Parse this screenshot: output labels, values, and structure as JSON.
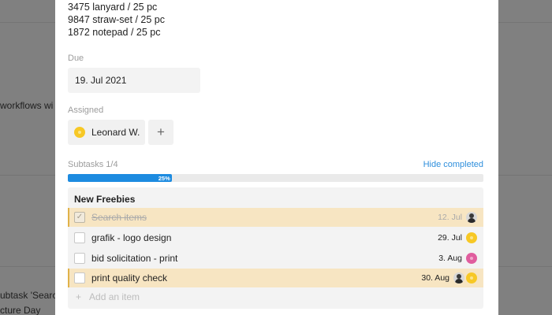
{
  "background": {
    "fragment_1": "workflows wi",
    "fragment_2": "ubtask 'Searc",
    "fragment_3": "cture Day"
  },
  "notes": {
    "lines": [
      "3475 lanyard / 25 pc",
      "9847 straw-set / 25 pc",
      "1872 notepad / 25 pc"
    ]
  },
  "due": {
    "label": "Due",
    "value": "19. Jul 2021"
  },
  "assigned": {
    "label": "Assigned",
    "name": "Leonard W.",
    "add_icon": "+"
  },
  "subtasks": {
    "label": "Subtasks 1/4",
    "hide_completed": "Hide completed",
    "progress_label": "25%",
    "progress_fraction": 0.25,
    "accent_color": "#1d8be0",
    "list_title": "New Freebies",
    "items": [
      {
        "text": "Search items",
        "date": "12. Jul",
        "completed": true,
        "highlighted": true,
        "avatars": [
          "photo"
        ]
      },
      {
        "text": "grafik - logo design",
        "date": "29. Jul",
        "completed": false,
        "highlighted": false,
        "avatars": [
          "yellow"
        ]
      },
      {
        "text": "bid solicitation - print",
        "date": "3. Aug",
        "completed": false,
        "highlighted": false,
        "avatars": [
          "pink"
        ]
      },
      {
        "text": "print quality check",
        "date": "30. Aug",
        "completed": false,
        "highlighted": true,
        "avatars": [
          "photo",
          "yellow"
        ]
      }
    ],
    "add_item_icon": "+",
    "add_item_placeholder": "Add an item"
  }
}
